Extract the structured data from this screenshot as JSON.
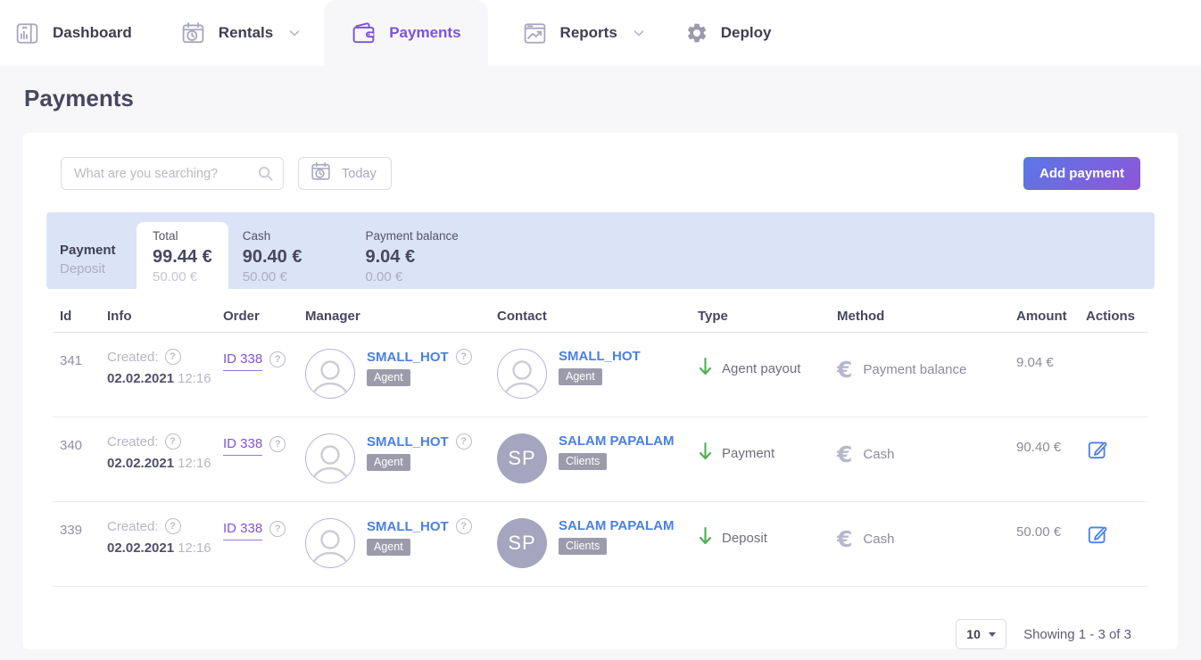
{
  "colors": {
    "accent_purple": "#7e52d8",
    "link_blue": "#4a80e3",
    "arrow_green": "#4cb050",
    "summary_bg": "#dbe3f7",
    "button_gradient_start": "#5a78e6",
    "button_gradient_end": "#8e55d9"
  },
  "icons": {
    "question": "?",
    "euro": "€"
  },
  "nav": {
    "dashboard": "Dashboard",
    "rentals": "Rentals",
    "payments": "Payments",
    "reports": "Reports",
    "deploy": "Deploy"
  },
  "page": {
    "title": "Payments"
  },
  "toolbar": {
    "search_placeholder": "What are you searching?",
    "date_filter": "Today",
    "add_payment": "Add payment"
  },
  "summary": {
    "row1_label": "Payment",
    "row2_label": "Deposit",
    "total": {
      "label": "Total",
      "payment": "99.44 €",
      "deposit": "50.00 €"
    },
    "cash": {
      "label": "Cash",
      "payment": "90.40 €",
      "deposit": "50.00 €"
    },
    "balance": {
      "label": "Payment balance",
      "payment": "9.04 €",
      "deposit": "0.00 €"
    }
  },
  "table": {
    "headers": {
      "id": "Id",
      "info": "Info",
      "order": "Order",
      "manager": "Manager",
      "contact": "Contact",
      "type": "Type",
      "method": "Method",
      "amount": "Amount",
      "actions": "Actions"
    },
    "rows": [
      {
        "id": "341",
        "info_label": "Created:",
        "date": "02.02.2021",
        "time": "12:16",
        "order": "ID 338",
        "manager_name": "SMALL_HOT",
        "manager_badge": "Agent",
        "contact_name": "SMALL_HOT",
        "contact_badge": "Agent",
        "type": "Agent payout",
        "method": "Payment balance",
        "amount": "9.04 €"
      },
      {
        "id": "340",
        "info_label": "Created:",
        "date": "02.02.2021",
        "time": "12:16",
        "order": "ID 338",
        "manager_name": "SMALL_HOT",
        "manager_badge": "Agent",
        "contact_name": "SALAM PAPALAM",
        "contact_badge": "Clients",
        "contact_initials": "SP",
        "type": "Payment",
        "method": "Cash",
        "amount": "90.40 €"
      },
      {
        "id": "339",
        "info_label": "Created:",
        "date": "02.02.2021",
        "time": "12:16",
        "order": "ID 338",
        "manager_name": "SMALL_HOT",
        "manager_badge": "Agent",
        "contact_name": "SALAM PAPALAM",
        "contact_badge": "Clients",
        "contact_initials": "SP",
        "type": "Deposit",
        "method": "Cash",
        "amount": "50.00 €"
      }
    ]
  },
  "pagination": {
    "page_size": "10",
    "showing": "Showing 1 - 3 of 3"
  }
}
